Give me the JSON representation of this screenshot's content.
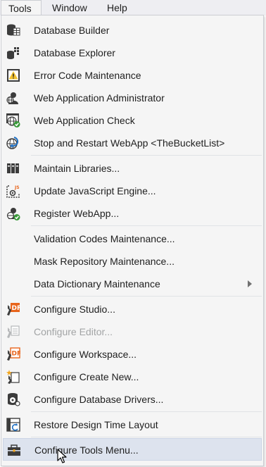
{
  "menubar": {
    "items": [
      {
        "label": "Tools"
      },
      {
        "label": "Window"
      },
      {
        "label": "Help"
      }
    ]
  },
  "menu": {
    "items": [
      {
        "label": "Database Builder",
        "icon": "database-builder-icon"
      },
      {
        "label": "Database Explorer",
        "icon": "database-explorer-icon"
      },
      {
        "label": "Error Code Maintenance",
        "icon": "warning-icon"
      },
      {
        "label": "Web Application Administrator",
        "icon": "web-admin-icon"
      },
      {
        "label": "Web Application Check",
        "icon": "web-check-icon"
      },
      {
        "label": "Stop and Restart WebApp <TheBucketList>",
        "icon": "restart-webapp-icon"
      },
      {
        "label": "Maintain Libraries...",
        "icon": "libraries-icon"
      },
      {
        "label": "Update JavaScript Engine...",
        "icon": "javascript-engine-icon"
      },
      {
        "label": "Register WebApp...",
        "icon": "register-webapp-icon"
      },
      {
        "label": "Validation Codes Maintenance..."
      },
      {
        "label": "Mask Repository Maintenance..."
      },
      {
        "label": "Data Dictionary Maintenance"
      },
      {
        "label": "Configure Studio...",
        "icon": "configure-studio-icon"
      },
      {
        "label": "Configure Editor...",
        "icon": "configure-editor-icon"
      },
      {
        "label": "Configure Workspace...",
        "icon": "configure-workspace-icon"
      },
      {
        "label": "Configure Create New...",
        "icon": "configure-create-new-icon"
      },
      {
        "label": "Configure Database Drivers...",
        "icon": "database-drivers-icon"
      },
      {
        "label": "Restore Design Time Layout",
        "icon": "restore-layout-icon"
      },
      {
        "label": "Configure Tools Menu...",
        "icon": "toolbox-icon"
      }
    ]
  },
  "colors": {
    "menu_background": "#f5f5f5",
    "hover_background": "#dde3ee",
    "disabled_text": "#a2a4a5",
    "accent_orange": "#e8641b",
    "icon_dark": "#3c3c3c",
    "check_green": "#3a9a3a"
  }
}
